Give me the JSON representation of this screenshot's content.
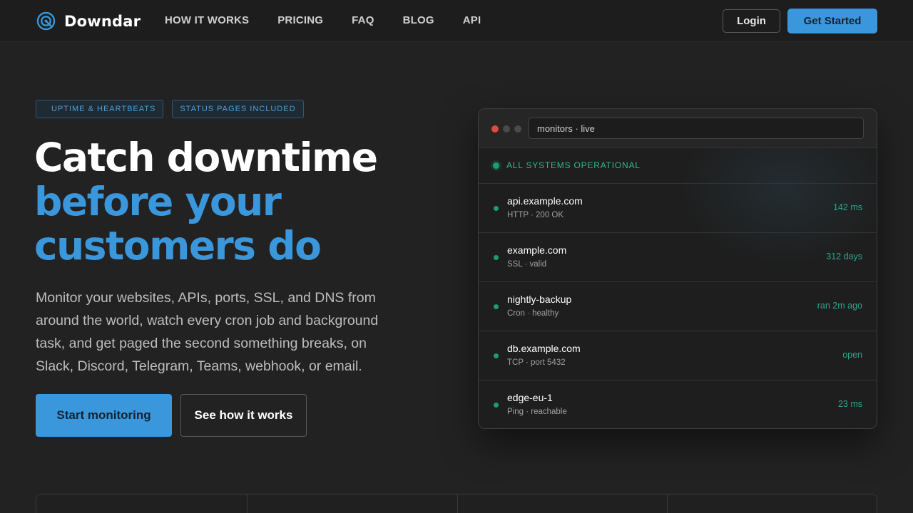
{
  "brand": {
    "name": "Downdar",
    "accent": "#3a97dc"
  },
  "nav": {
    "links": [
      "HOW IT WORKS",
      "PRICING",
      "FAQ",
      "BLOG",
      "API"
    ],
    "login_label": "Login",
    "cta_label": "Get Started"
  },
  "hero": {
    "badges": [
      "UPTIME & HEARTBEATS",
      "STATUS PAGES INCLUDED"
    ],
    "headline_line1": "Catch downtime",
    "headline_line2": "before your",
    "headline_line3": "customers do",
    "description": "Monitor your websites, APIs, ports, SSL, and DNS from around the world, watch every cron job and background task, and get paged the second something breaks, on Slack, Discord, Telegram, Teams, webhook, or email.",
    "primary_button": "Start monitoring",
    "secondary_button": "See how it works"
  },
  "monitor_window": {
    "url": "monitors · live",
    "status": "ALL SYSTEMS OPERATIONAL",
    "status_color": "#1aa06a",
    "rows": [
      {
        "name": "api.example.com",
        "detail": "HTTP · 200 OK",
        "value": "142 ms"
      },
      {
        "name": "example.com",
        "detail": "SSL · valid",
        "value": "312 days"
      },
      {
        "name": "nightly-backup",
        "detail": "Cron · healthy",
        "value": "ran 2m ago"
      },
      {
        "name": "db.example.com",
        "detail": "TCP · port 5432",
        "value": "open"
      },
      {
        "name": "edge-eu-1",
        "detail": "Ping · reachable",
        "value": "23 ms"
      }
    ]
  }
}
